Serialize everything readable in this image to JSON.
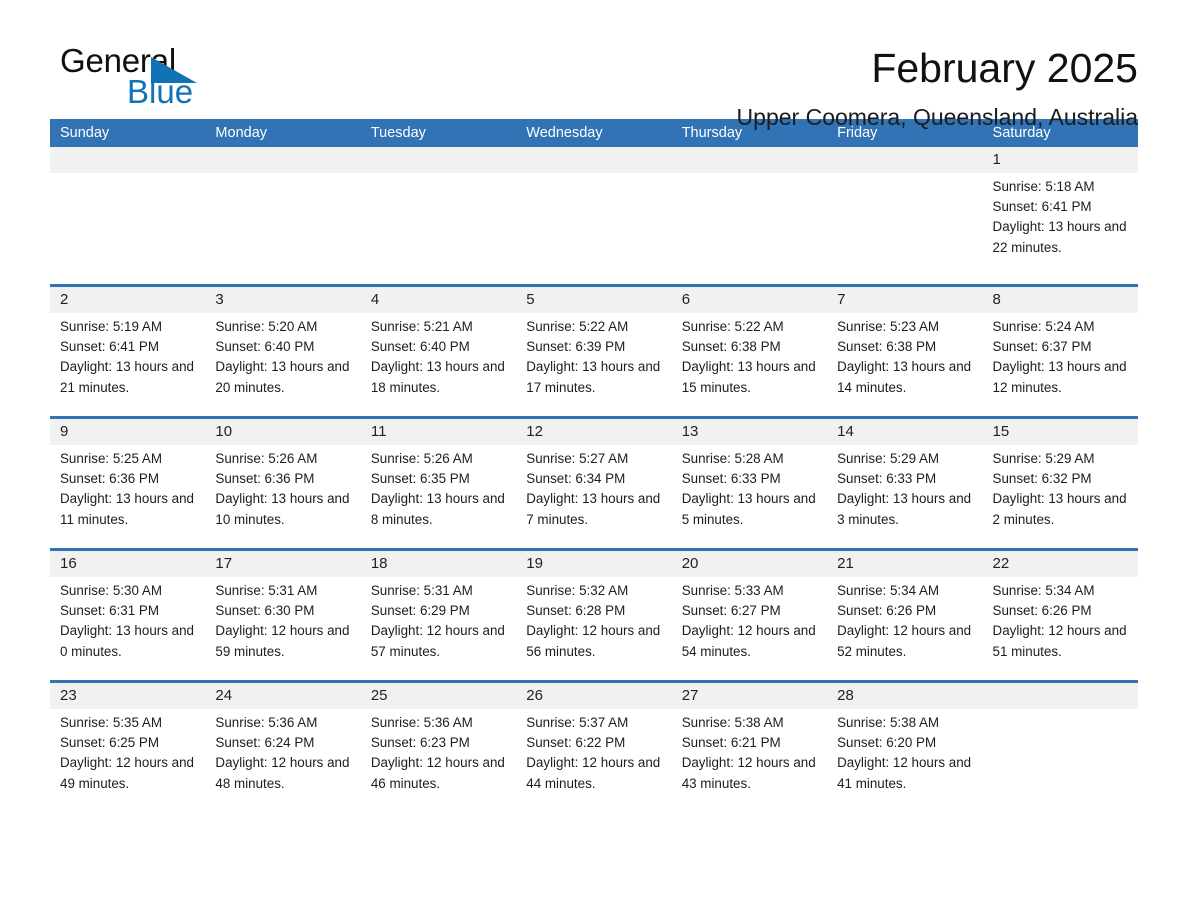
{
  "brand": {
    "name_part1": "General",
    "name_part2": "Blue",
    "accent_color": "#1272b6",
    "triangle_icon": "brand-triangle-icon"
  },
  "header": {
    "title": "February 2025",
    "location": "Upper Coomera, Queensland, Australia"
  },
  "calendar": {
    "header_color": "#3173b5",
    "daynum_band_color": "#f1f1f1",
    "day_names": [
      "Sunday",
      "Monday",
      "Tuesday",
      "Wednesday",
      "Thursday",
      "Friday",
      "Saturday"
    ],
    "weeks": [
      [
        {
          "day": "",
          "lines": []
        },
        {
          "day": "",
          "lines": []
        },
        {
          "day": "",
          "lines": []
        },
        {
          "day": "",
          "lines": []
        },
        {
          "day": "",
          "lines": []
        },
        {
          "day": "",
          "lines": []
        },
        {
          "day": "1",
          "lines": [
            "Sunrise: 5:18 AM",
            "Sunset: 6:41 PM",
            "Daylight: 13 hours and 22 minutes."
          ]
        }
      ],
      [
        {
          "day": "2",
          "lines": [
            "Sunrise: 5:19 AM",
            "Sunset: 6:41 PM",
            "Daylight: 13 hours and 21 minutes."
          ]
        },
        {
          "day": "3",
          "lines": [
            "Sunrise: 5:20 AM",
            "Sunset: 6:40 PM",
            "Daylight: 13 hours and 20 minutes."
          ]
        },
        {
          "day": "4",
          "lines": [
            "Sunrise: 5:21 AM",
            "Sunset: 6:40 PM",
            "Daylight: 13 hours and 18 minutes."
          ]
        },
        {
          "day": "5",
          "lines": [
            "Sunrise: 5:22 AM",
            "Sunset: 6:39 PM",
            "Daylight: 13 hours and 17 minutes."
          ]
        },
        {
          "day": "6",
          "lines": [
            "Sunrise: 5:22 AM",
            "Sunset: 6:38 PM",
            "Daylight: 13 hours and 15 minutes."
          ]
        },
        {
          "day": "7",
          "lines": [
            "Sunrise: 5:23 AM",
            "Sunset: 6:38 PM",
            "Daylight: 13 hours and 14 minutes."
          ]
        },
        {
          "day": "8",
          "lines": [
            "Sunrise: 5:24 AM",
            "Sunset: 6:37 PM",
            "Daylight: 13 hours and 12 minutes."
          ]
        }
      ],
      [
        {
          "day": "9",
          "lines": [
            "Sunrise: 5:25 AM",
            "Sunset: 6:36 PM",
            "Daylight: 13 hours and 11 minutes."
          ]
        },
        {
          "day": "10",
          "lines": [
            "Sunrise: 5:26 AM",
            "Sunset: 6:36 PM",
            "Daylight: 13 hours and 10 minutes."
          ]
        },
        {
          "day": "11",
          "lines": [
            "Sunrise: 5:26 AM",
            "Sunset: 6:35 PM",
            "Daylight: 13 hours and 8 minutes."
          ]
        },
        {
          "day": "12",
          "lines": [
            "Sunrise: 5:27 AM",
            "Sunset: 6:34 PM",
            "Daylight: 13 hours and 7 minutes."
          ]
        },
        {
          "day": "13",
          "lines": [
            "Sunrise: 5:28 AM",
            "Sunset: 6:33 PM",
            "Daylight: 13 hours and 5 minutes."
          ]
        },
        {
          "day": "14",
          "lines": [
            "Sunrise: 5:29 AM",
            "Sunset: 6:33 PM",
            "Daylight: 13 hours and 3 minutes."
          ]
        },
        {
          "day": "15",
          "lines": [
            "Sunrise: 5:29 AM",
            "Sunset: 6:32 PM",
            "Daylight: 13 hours and 2 minutes."
          ]
        }
      ],
      [
        {
          "day": "16",
          "lines": [
            "Sunrise: 5:30 AM",
            "Sunset: 6:31 PM",
            "Daylight: 13 hours and 0 minutes."
          ]
        },
        {
          "day": "17",
          "lines": [
            "Sunrise: 5:31 AM",
            "Sunset: 6:30 PM",
            "Daylight: 12 hours and 59 minutes."
          ]
        },
        {
          "day": "18",
          "lines": [
            "Sunrise: 5:31 AM",
            "Sunset: 6:29 PM",
            "Daylight: 12 hours and 57 minutes."
          ]
        },
        {
          "day": "19",
          "lines": [
            "Sunrise: 5:32 AM",
            "Sunset: 6:28 PM",
            "Daylight: 12 hours and 56 minutes."
          ]
        },
        {
          "day": "20",
          "lines": [
            "Sunrise: 5:33 AM",
            "Sunset: 6:27 PM",
            "Daylight: 12 hours and 54 minutes."
          ]
        },
        {
          "day": "21",
          "lines": [
            "Sunrise: 5:34 AM",
            "Sunset: 6:26 PM",
            "Daylight: 12 hours and 52 minutes."
          ]
        },
        {
          "day": "22",
          "lines": [
            "Sunrise: 5:34 AM",
            "Sunset: 6:26 PM",
            "Daylight: 12 hours and 51 minutes."
          ]
        }
      ],
      [
        {
          "day": "23",
          "lines": [
            "Sunrise: 5:35 AM",
            "Sunset: 6:25 PM",
            "Daylight: 12 hours and 49 minutes."
          ]
        },
        {
          "day": "24",
          "lines": [
            "Sunrise: 5:36 AM",
            "Sunset: 6:24 PM",
            "Daylight: 12 hours and 48 minutes."
          ]
        },
        {
          "day": "25",
          "lines": [
            "Sunrise: 5:36 AM",
            "Sunset: 6:23 PM",
            "Daylight: 12 hours and 46 minutes."
          ]
        },
        {
          "day": "26",
          "lines": [
            "Sunrise: 5:37 AM",
            "Sunset: 6:22 PM",
            "Daylight: 12 hours and 44 minutes."
          ]
        },
        {
          "day": "27",
          "lines": [
            "Sunrise: 5:38 AM",
            "Sunset: 6:21 PM",
            "Daylight: 12 hours and 43 minutes."
          ]
        },
        {
          "day": "28",
          "lines": [
            "Sunrise: 5:38 AM",
            "Sunset: 6:20 PM",
            "Daylight: 12 hours and 41 minutes."
          ]
        },
        {
          "day": "",
          "lines": []
        }
      ]
    ]
  }
}
